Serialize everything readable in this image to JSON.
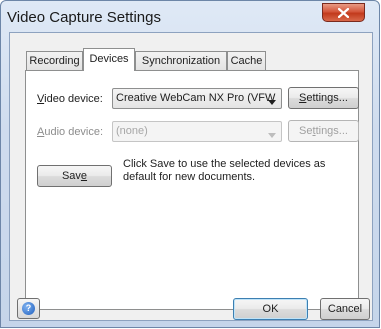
{
  "window": {
    "title": "Video Capture Settings",
    "close_icon": "close-icon"
  },
  "tabs": [
    {
      "label": "Recording",
      "active": false
    },
    {
      "label": "Devices",
      "active": true
    },
    {
      "label": "Synchronization",
      "active": false
    },
    {
      "label": "Cache",
      "active": false
    }
  ],
  "devices": {
    "video_label_key": "V",
    "video_label_rest": "ideo device:",
    "video_value": "Creative WebCam NX Pro (VFW",
    "video_settings_key": "S",
    "video_settings_rest": "ettings...",
    "audio_label_key": "A",
    "audio_label_rest": "udio device:",
    "audio_value": "(none)",
    "audio_settings_pre": "Se",
    "audio_settings_key": "t",
    "audio_settings_rest": "tings...",
    "save_pre": "Sav",
    "save_key": "e",
    "save_hint": "Click Save to use the selected devices as default for new documents."
  },
  "footer": {
    "help_icon": "help-icon",
    "help_glyph": "?",
    "ok_label": "OK",
    "cancel_label": "Cancel"
  },
  "colors": {
    "title_bar": "#cfdcee",
    "close_button": "#c9452a",
    "default_button_border": "#3c7fb1"
  }
}
